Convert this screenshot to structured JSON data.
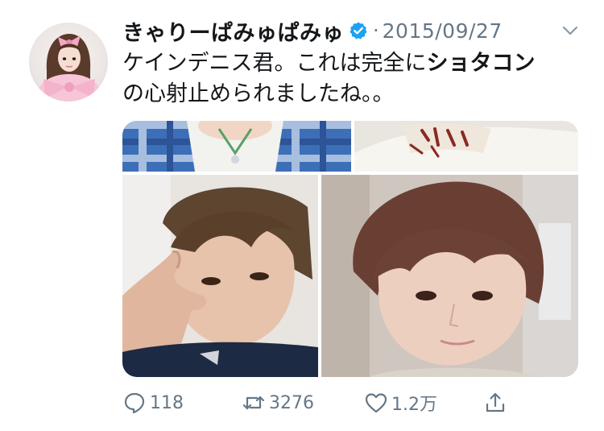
{
  "tweet": {
    "display_name": "きゃりーぱみゅぱみゅ",
    "verified": true,
    "separator": "·",
    "timestamp": "2015/09/27",
    "text_line1": "ケインデニス君。これは完全に",
    "text_bold": "ショタコン",
    "text_line2": "の心射止められましたね。。",
    "media_count": 4,
    "stats": {
      "replies": "118",
      "retweets": "3276",
      "likes": "1.2万"
    }
  },
  "icons": {
    "verified": "verified-badge-icon",
    "caret": "chevron-down-icon",
    "reply": "reply-icon",
    "retweet": "retweet-icon",
    "like": "heart-icon",
    "share": "share-icon"
  },
  "colors": {
    "text": "#14171a",
    "muted": "#657786",
    "verified": "#1da1f2"
  }
}
